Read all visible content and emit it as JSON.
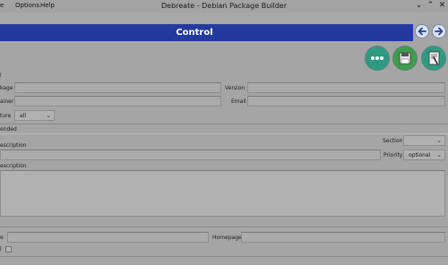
{
  "window": {
    "title": "Debreate - Debian Package Builder"
  },
  "menu": {
    "items": [
      "e",
      "Options",
      "Help"
    ]
  },
  "page": {
    "title": "Control"
  },
  "form": {
    "section_label": "l",
    "package_label": "kage",
    "version_label": "Version",
    "maintainer_label": "ainer",
    "email_label": "Email",
    "architecture_label": "ture",
    "architecture_value": "all",
    "recommended_label": "ended",
    "section_field_label": "Section",
    "short_description_label": "escription",
    "priority_label": "Priority",
    "priority_value": "optional",
    "long_description_label": "escription",
    "source_label": "e",
    "homepage_label": "Homepage",
    "essential_label": "l"
  },
  "colors": {
    "banner": "#233a9c",
    "window_background": "#a5a5a5",
    "round_button_teal": "#2f9a82",
    "round_button_green": "#3e9c4c"
  },
  "icons": [
    "chevron-down-icon",
    "chevron-up-icon",
    "close-icon",
    "nav-back-icon",
    "nav-forward-icon",
    "more-options-icon",
    "save-icon",
    "preview-icon"
  ]
}
